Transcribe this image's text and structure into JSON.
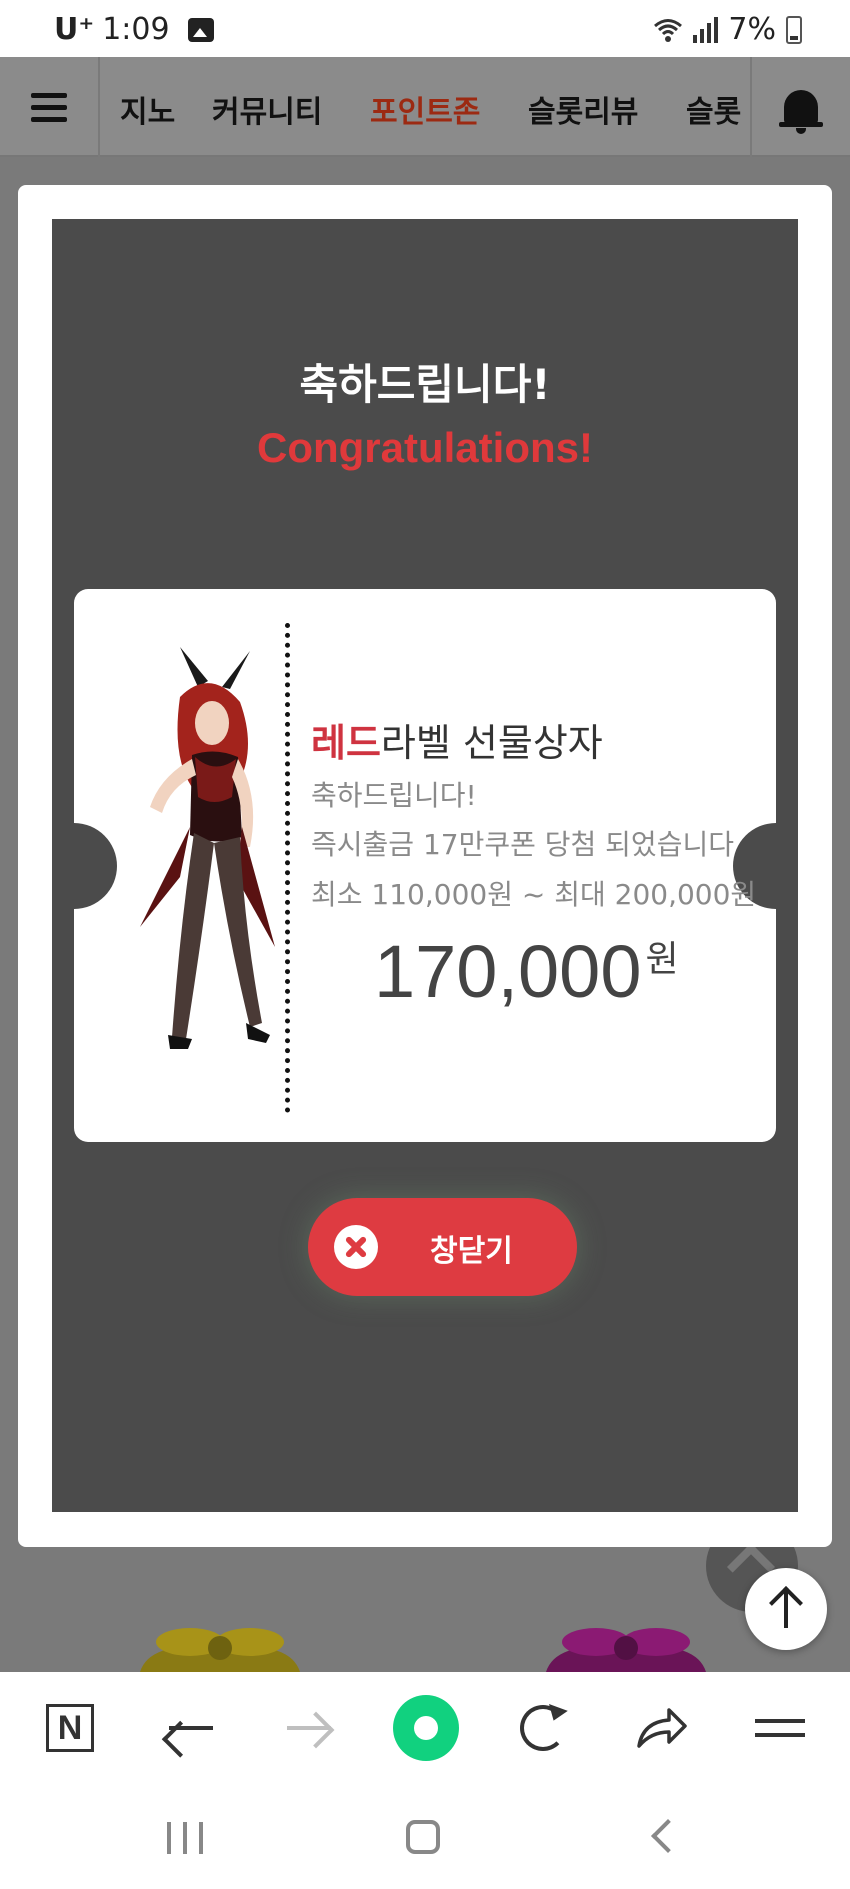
{
  "status_bar": {
    "carrier": "U⁺",
    "time": "1:09",
    "battery": "7%"
  },
  "nav": {
    "tabs": [
      "지노",
      "커뮤니티",
      "포인트존",
      "슬롯리뷰",
      "슬롯"
    ],
    "active_tab": "포인트존"
  },
  "modal": {
    "title_ko": "축하드립니다!",
    "title_en": "Congratulations!",
    "prize": {
      "name_highlight": "레드",
      "name_rest": "라벨 선물상자",
      "line1": "축하드립니다!",
      "line2": "즉시출금 17만쿠폰 당첨 되었습니다",
      "line3": "최소 110,000원 ~ 최대 200,000원",
      "amount": "170,000",
      "unit": "원"
    },
    "close_label": "창닫기"
  },
  "browser_bar": {
    "icons": [
      "naver-n-icon",
      "back-arrow-icon",
      "forward-arrow-icon",
      "green-circle-icon",
      "reload-icon",
      "share-icon",
      "menu-icon"
    ],
    "naver_letter": "N"
  },
  "colors": {
    "accent_red": "#de3b41",
    "active_tab": "#9c2a12",
    "modal_bg": "#4b4b4b",
    "green": "#11d17f"
  }
}
